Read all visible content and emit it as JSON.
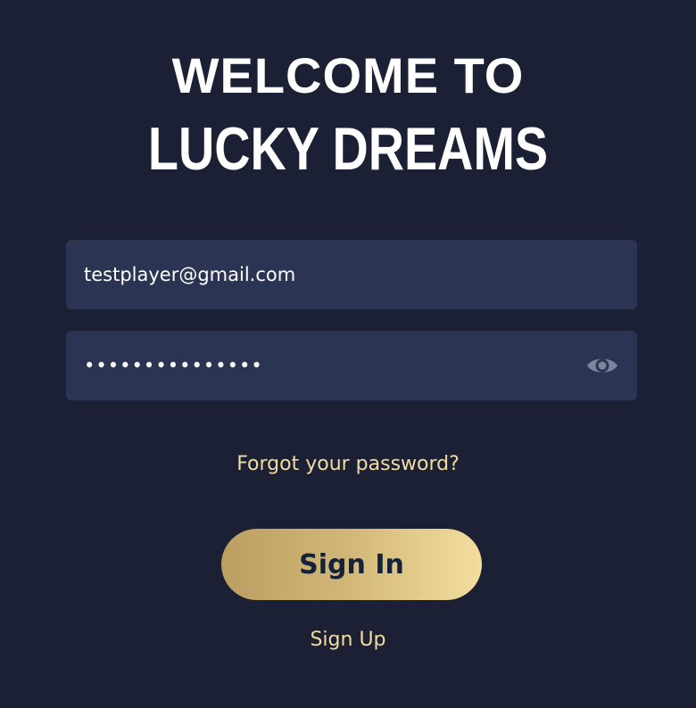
{
  "header": {
    "title_line1": "WELCOME TO",
    "title_line2": "LUCKY DREAMS"
  },
  "form": {
    "email": {
      "value": "testplayer@gmail.com"
    },
    "password": {
      "value": "•••••••••••••••",
      "toggle_icon": "eye-icon"
    },
    "forgot_label": "Forgot your password?",
    "signin_label": "Sign In",
    "signup_label": "Sign Up"
  },
  "colors": {
    "background": "#1b2034",
    "field": "#2c3454",
    "accent_text": "#f2dca0",
    "button_gradient_start": "#bb9e62",
    "button_gradient_end": "#f3de9f",
    "button_text": "#14213a"
  }
}
